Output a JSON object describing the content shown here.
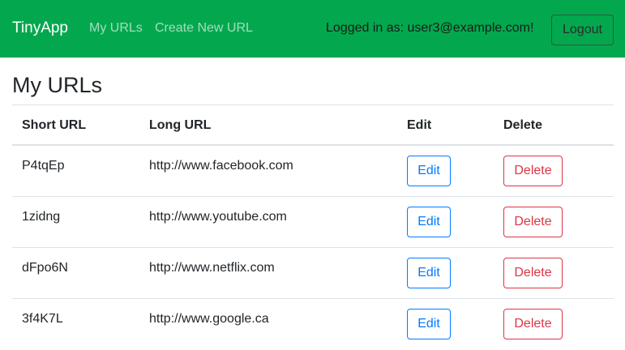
{
  "navbar": {
    "brand": "TinyApp",
    "links": [
      {
        "label": "My URLs"
      },
      {
        "label": "Create New URL"
      }
    ],
    "logged_in_text": "Logged in as: user3@example.com!",
    "logout_label": "Logout",
    "background_color": "#03a84e"
  },
  "main": {
    "title": "My URLs",
    "table": {
      "headers": [
        "Short URL",
        "Long URL",
        "Edit",
        "Delete"
      ],
      "rows": [
        {
          "short": "P4tqEp",
          "long": "http://www.facebook.com",
          "edit": "Edit",
          "delete": "Delete"
        },
        {
          "short": "1zidng",
          "long": "http://www.youtube.com",
          "edit": "Edit",
          "delete": "Delete"
        },
        {
          "short": "dFpo6N",
          "long": "http://www.netflix.com",
          "edit": "Edit",
          "delete": "Delete"
        },
        {
          "short": "3f4K7L",
          "long": "http://www.google.ca",
          "edit": "Edit",
          "delete": "Delete"
        }
      ]
    }
  },
  "colors": {
    "edit": "#007bff",
    "delete": "#dc3545"
  }
}
